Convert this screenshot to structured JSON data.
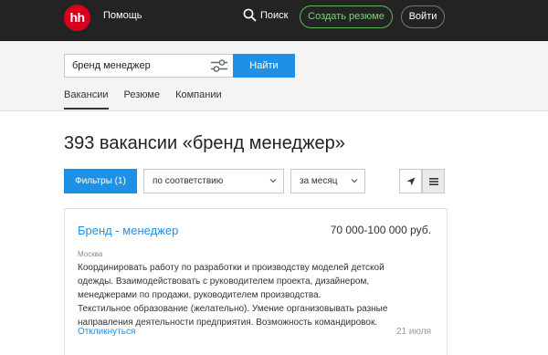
{
  "header": {
    "logo_text": "hh",
    "help_label": "Помощь",
    "search_label": "Поиск",
    "create_resume_label": "Создать резюме",
    "login_label": "Войти",
    "colors": {
      "bar": "#232323",
      "logo": "#d6001c",
      "accent_green": "#7ed07e"
    }
  },
  "search": {
    "query": "бренд менеджер",
    "find_label": "Найти",
    "tabs": [
      {
        "label": "Вакансии",
        "active": true
      },
      {
        "label": "Резюме",
        "active": false
      },
      {
        "label": "Компании",
        "active": false
      }
    ]
  },
  "results": {
    "heading": "393 вакансии «бренд менеджер»",
    "filters_label": "Фильтры (1)",
    "sort_value": "по соответствию",
    "period_value": "за месяц",
    "view_icons": [
      "location-arrow-icon",
      "list-icon"
    ]
  },
  "vacancy": {
    "title": "Бренд - менеджер",
    "salary": "70 000-100 000 руб.",
    "city": "Москва",
    "description": [
      "Координировать работу по разработки и производству моделей детской",
      "одежды. Взаимодействовать с руководителем проекта, дизайнером,",
      "менеджерами по продажи, руководителем производства.",
      "Текстильное образование (желательно). Умение организовывать разные",
      "направления деятельности предприятия. Возможность командировок."
    ],
    "respond_label": "Откликнуться",
    "date": "21 июля"
  }
}
